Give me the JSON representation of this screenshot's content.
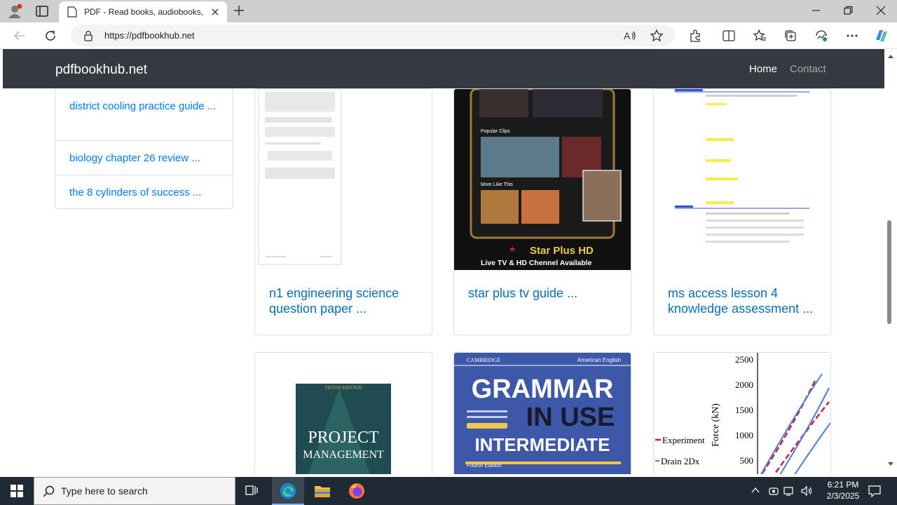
{
  "browser": {
    "tab_title": "PDF - Read books, audiobooks, a",
    "url": "https://pdfbookhub.net"
  },
  "site": {
    "brand": "pdfbookhub.net",
    "nav": {
      "home": "Home",
      "contact": "Contact"
    }
  },
  "sidebar": {
    "items": [
      {
        "label": "district cooling practice guide ..."
      },
      {
        "label": "biology chapter 26 review ..."
      },
      {
        "label": "the 8 cylinders of success ..."
      }
    ]
  },
  "cards_row1": [
    {
      "title": "n1 engineering science question paper ..."
    },
    {
      "title": "star plus tv guide ..."
    },
    {
      "title": "ms access lesson 4 knowledge assessment ..."
    }
  ],
  "cards_row2_images": {
    "pm_cover": {
      "edition": "TENTH EDITION",
      "title_line1": "PROJECT",
      "title_line2": "MANAGEMENT"
    },
    "grammar_cover": {
      "publisher": "CAMBRIDGE",
      "variant": "American English",
      "line1": "GRAMMAR",
      "line2": "IN USE",
      "line3": "INTERMEDIATE",
      "edition": "Fourth Edition"
    },
    "chart": {
      "ylabel": "Force (kN)",
      "ticks": [
        "2500",
        "2000",
        "1500",
        "1000",
        "500"
      ],
      "legend": [
        "Experiment",
        "Drain 2Dx"
      ]
    }
  },
  "starplus": {
    "brand": "Star Plus HD",
    "caption": "Live TV & HD Chennel Available",
    "popular": "Popular Clips",
    "more": "More Like This"
  },
  "taskbar": {
    "search_placeholder": "Type here to search",
    "time": "6:21 PM",
    "date": "2/3/2025"
  },
  "colors": {
    "navbar": "#343a40",
    "link": "#007bff",
    "taskbar": "#1f2a35"
  }
}
